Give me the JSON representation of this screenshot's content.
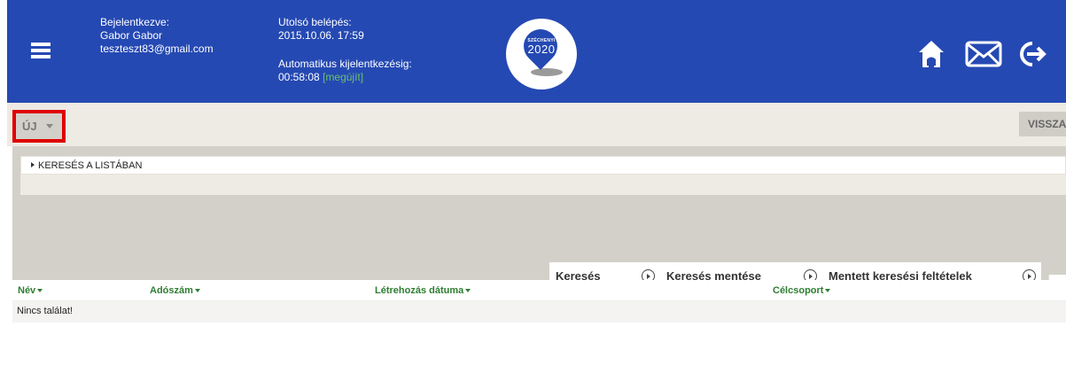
{
  "header": {
    "logged_in_label": "Bejelentkezve:",
    "user_name": "Gabor Gabor",
    "user_email": "teszteszt83@gmail.com",
    "last_login_label": "Utolsó belépés:",
    "last_login_value": "2015.10.06. 17:59",
    "auto_logout_label": "Automatikus kijelentkezésig:",
    "auto_logout_value": "00:58:08",
    "renew_link": "[megújít]",
    "logo_small": "SZÉCHENYI",
    "logo_big": "2020",
    "colors": {
      "header_bg": "#2549b3",
      "renew_link": "#6ac06a"
    }
  },
  "toolbar": {
    "new_button": "ÚJ",
    "back_button": "VISSZA"
  },
  "search": {
    "toggle_label": "KERESÉS A LISTÁBAN",
    "buttons": {
      "search": "Keresés",
      "save_search": "Keresés mentése",
      "saved_filters": "Mentett keresési feltételek"
    }
  },
  "table": {
    "columns": [
      "Név",
      "Adószám",
      "Létrehozás dátuma",
      "Célcsoport"
    ],
    "empty_message": "Nincs találat!",
    "header_color": "#2e7d32"
  }
}
